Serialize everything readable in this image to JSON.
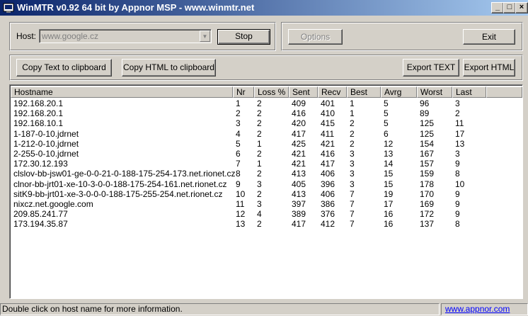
{
  "window": {
    "title": "WinMTR v0.92 64 bit by Appnor MSP - www.winmtr.net",
    "minimize": "_",
    "maximize": "□",
    "close": "×"
  },
  "host": {
    "label": "Host:",
    "value": "www.google.cz"
  },
  "buttons": {
    "stop": "Stop",
    "options": "Options",
    "exit": "Exit",
    "copy_text": "Copy Text to clipboard",
    "copy_html": "Copy HTML to clipboard",
    "export_text": "Export TEXT",
    "export_html": "Export HTML"
  },
  "table": {
    "columns": [
      "Hostname",
      "Nr",
      "Loss %",
      "Sent",
      "Recv",
      "Best",
      "Avrg",
      "Worst",
      "Last"
    ],
    "rows": [
      [
        "192.168.20.1",
        "1",
        "2",
        "409",
        "401",
        "1",
        "5",
        "96",
        "3"
      ],
      [
        "192.168.20.1",
        "2",
        "2",
        "416",
        "410",
        "1",
        "5",
        "89",
        "2"
      ],
      [
        "192.168.10.1",
        "3",
        "2",
        "420",
        "415",
        "2",
        "5",
        "125",
        "11"
      ],
      [
        "1-187-0-10.jdrnet",
        "4",
        "2",
        "417",
        "411",
        "2",
        "6",
        "125",
        "17"
      ],
      [
        "1-212-0-10.jdrnet",
        "5",
        "1",
        "425",
        "421",
        "2",
        "12",
        "154",
        "13"
      ],
      [
        "2-255-0-10.jdrnet",
        "6",
        "2",
        "421",
        "416",
        "3",
        "13",
        "167",
        "3"
      ],
      [
        "172.30.12.193",
        "7",
        "1",
        "421",
        "417",
        "3",
        "14",
        "157",
        "9"
      ],
      [
        "clslov-bb-jsw01-ge-0-0-21-0-188-175-254-173.net.rionet.cz",
        "8",
        "2",
        "413",
        "406",
        "3",
        "15",
        "159",
        "8"
      ],
      [
        "clnor-bb-jrt01-xe-10-3-0-0-188-175-254-161.net.rionet.cz",
        "9",
        "3",
        "405",
        "396",
        "3",
        "15",
        "178",
        "10"
      ],
      [
        "sitK9-bb-jrt01-xe-3-0-0-0-188-175-255-254.net.rionet.cz",
        "10",
        "2",
        "413",
        "406",
        "7",
        "19",
        "170",
        "9"
      ],
      [
        "nixcz.net.google.com",
        "11",
        "3",
        "397",
        "386",
        "7",
        "17",
        "169",
        "9"
      ],
      [
        "209.85.241.77",
        "12",
        "4",
        "389",
        "376",
        "7",
        "16",
        "172",
        "9"
      ],
      [
        "173.194.35.87",
        "13",
        "2",
        "417",
        "412",
        "7",
        "16",
        "137",
        "8"
      ]
    ]
  },
  "status": {
    "message": "Double click on host name for more information.",
    "link": "www.appnor.com"
  }
}
